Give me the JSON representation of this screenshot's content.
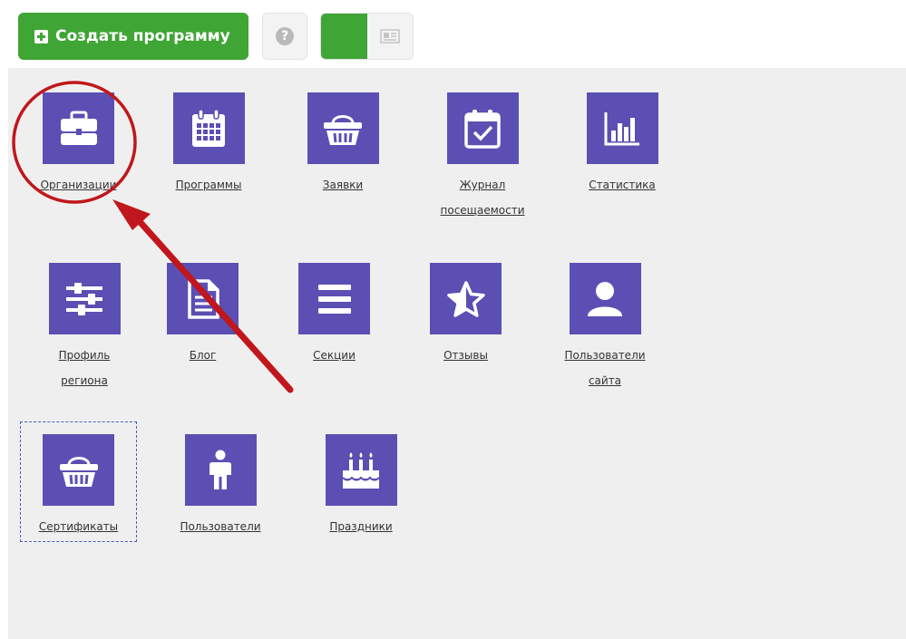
{
  "toolbar": {
    "create_label": "Создать программу",
    "help_glyph": "?"
  },
  "tiles": [
    {
      "label": "Организации",
      "icon": "briefcase-icon"
    },
    {
      "label": "Программы",
      "icon": "calendar-icon"
    },
    {
      "label": "Заявки",
      "icon": "basket-icon"
    },
    {
      "label": "Журнал\nпосещаемости",
      "icon": "calendar-check-icon"
    },
    {
      "label": "Статистика",
      "icon": "bar-chart-icon"
    },
    {
      "label": "Профиль\nрегиона",
      "icon": "sliders-icon"
    },
    {
      "label": "Блог",
      "icon": "document-icon"
    },
    {
      "label": "Секции",
      "icon": "list-icon"
    },
    {
      "label": "Отзывы",
      "icon": "star-half-icon"
    },
    {
      "label": "Пользователи\nсайта",
      "icon": "user-icon"
    },
    {
      "label": "Сертификаты",
      "icon": "basket-icon"
    },
    {
      "label": "Пользователи",
      "icon": "person-icon"
    },
    {
      "label": "Праздники",
      "icon": "cake-icon"
    }
  ],
  "colors": {
    "brand_green": "#3fa535",
    "tile_purple": "#5b4fb3",
    "annotation_red": "#c0171c",
    "panel_bg": "#efefef"
  }
}
